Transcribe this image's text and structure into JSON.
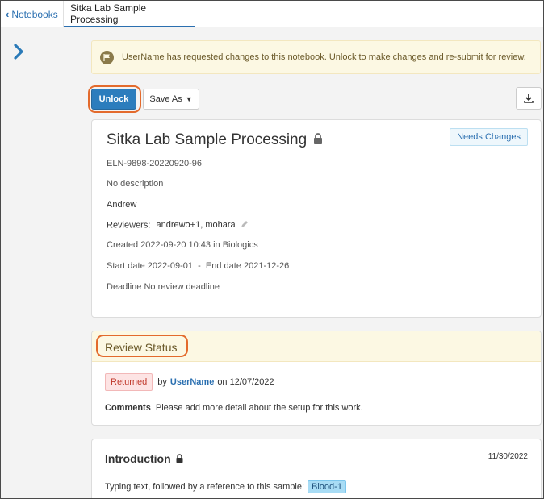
{
  "tabs": {
    "back_label": "Notebooks",
    "active_label": "Sitka Lab Sample Processing"
  },
  "banner": {
    "message": "UserName has requested changes to this notebook. Unlock to make changes and re-submit for review."
  },
  "toolbar": {
    "unlock_label": "Unlock",
    "save_as_label": "Save As"
  },
  "notebook": {
    "title": "Sitka Lab Sample Processing",
    "status_badge": "Needs Changes",
    "id": "ELN-9898-20220920-96",
    "description": "No description",
    "author": "Andrew",
    "reviewers_label": "Reviewers:",
    "reviewers": "andrewo+1, mohara",
    "created": "Created 2022-09-20 10:43 in Biologics",
    "dates": "Start date 2022-09-01  -  End date 2021-12-26",
    "deadline_label": "Deadline",
    "deadline_value": "No review deadline"
  },
  "review": {
    "title": "Review Status",
    "status": "Returned",
    "by_label": "by",
    "user": "UserName",
    "on_label": "on 12/07/2022",
    "comments_label": "Comments",
    "comments_text": "Please add more detail about the setup for this work."
  },
  "intro": {
    "title": "Introduction",
    "date": "11/30/2022",
    "text": "Typing text, followed by a reference to this sample:",
    "sample_ref": "Blood-1"
  },
  "colors": {
    "accent": "#2c7dbd",
    "highlight_ring": "#e36a2c",
    "warning_bg": "#fcf8e3",
    "returned_bg": "#fde4e4"
  }
}
